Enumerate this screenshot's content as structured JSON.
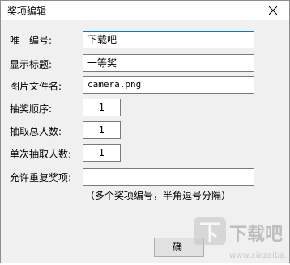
{
  "window": {
    "title": "奖项编辑",
    "close_icon": "close-icon"
  },
  "form": {
    "id_label": "唯一编号:",
    "id_value": "下载吧",
    "display_title_label": "显示标题:",
    "display_title_value": "一等奖",
    "image_file_label": "图片文件名:",
    "image_file_value": "camera.png",
    "draw_order_label": "抽奖顺序:",
    "draw_order_value": "1",
    "total_winners_label": "抽取总人数:",
    "total_winners_value": "1",
    "per_draw_label": "单次抽取人数:",
    "per_draw_value": "1",
    "allow_repeat_label": "允许重复奖项:",
    "allow_repeat_value": "",
    "allow_repeat_hint": "（多个奖项编号，半角逗号分隔）"
  },
  "buttons": {
    "ok_label": "确"
  },
  "watermark": {
    "text": "下载吧",
    "url": "www.xiazaiba.com"
  }
}
